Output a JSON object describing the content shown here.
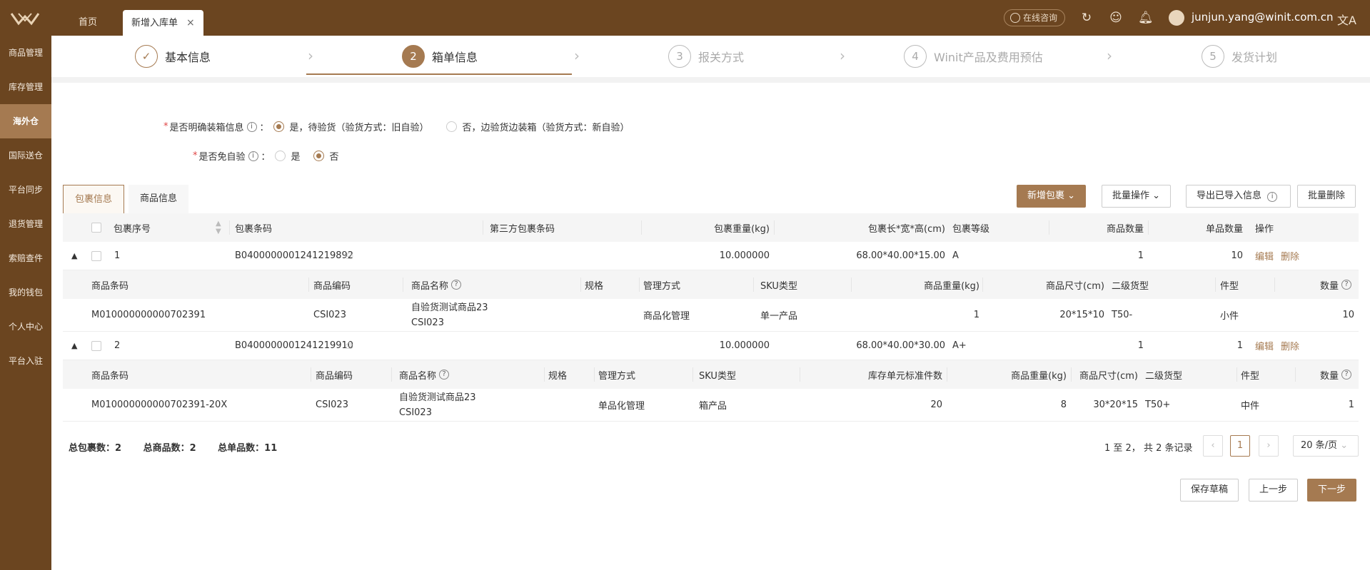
{
  "header": {
    "tabs": [
      {
        "label": "首页"
      },
      {
        "label": "新增入库单"
      }
    ],
    "consult_label": "在线咨询",
    "user": "junjun.yang@winit.com.cn",
    "lang_icon": "文A"
  },
  "sidebar": {
    "items": [
      {
        "label": "商品管理"
      },
      {
        "label": "库存管理"
      },
      {
        "label": "海外仓"
      },
      {
        "label": "国际送仓"
      },
      {
        "label": "平台同步"
      },
      {
        "label": "退货管理"
      },
      {
        "label": "索赔查件"
      },
      {
        "label": "我的钱包"
      },
      {
        "label": "个人中心"
      },
      {
        "label": "平台入驻"
      }
    ],
    "active_index": 2
  },
  "steps": [
    {
      "num": "✓",
      "label": "基本信息"
    },
    {
      "num": "2",
      "label": "箱单信息"
    },
    {
      "num": "3",
      "label": "报关方式"
    },
    {
      "num": "4",
      "label": "Winit产品及费用预估"
    },
    {
      "num": "5",
      "label": "发货计划"
    }
  ],
  "form": {
    "q1_label": "是否明确装箱信息",
    "q1_opt1": "是，待验货（验货方式：旧自验）",
    "q1_opt2": "否，边验货边装箱（验货方式：新自验）",
    "q2_label": "是否免自验",
    "q2_opt1": "是",
    "q2_opt2": "否"
  },
  "subtabs": {
    "pkg": "包裹信息",
    "goods": "商品信息"
  },
  "toolbar": {
    "add": "新增包裹",
    "batch": "批量操作",
    "export": "导出已导入信息",
    "batch_delete": "批量删除"
  },
  "table": {
    "headers": {
      "seq": "包裹序号",
      "barcode": "包裹条码",
      "third": "第三方包裹条码",
      "weight": "包裹重量(kg)",
      "dims": "包裹长*宽*高(cm)",
      "grade": "包裹等级",
      "goods_qty": "商品数量",
      "unit_qty": "单品数量",
      "ops": "操作"
    },
    "rows": [
      {
        "seq": "1",
        "barcode": "B0400000001241219892",
        "weight": "10.000000",
        "dims": "68.00*40.00*15.00",
        "grade": "A",
        "goods_qty": "1",
        "unit_qty": "10",
        "edit": "编辑",
        "del": "删除"
      },
      {
        "seq": "2",
        "barcode": "B0400000001241219910",
        "weight": "10.000000",
        "dims": "68.00*40.00*30.00",
        "grade": "A+",
        "goods_qty": "1",
        "unit_qty": "1",
        "edit": "编辑",
        "del": "删除"
      }
    ],
    "sub1": {
      "headers": {
        "barcode": "商品条码",
        "code": "商品编码",
        "name": "商品名称",
        "spec": "规格",
        "mgmt": "管理方式",
        "sku": "SKU类型",
        "weight": "商品重量(kg)",
        "size": "商品尺寸(cm)",
        "cat2": "二级货型",
        "type": "件型",
        "qty": "数量"
      },
      "row": {
        "barcode": "M010000000000702391",
        "code": "CSI023",
        "name1": "自验货测试商品23",
        "name2": "CSI023",
        "spec": "",
        "mgmt": "商品化管理",
        "sku": "单一产品",
        "weight": "1",
        "size": "20*15*10",
        "cat2": "T50-",
        "type": "小件",
        "qty": "10"
      }
    },
    "sub2": {
      "headers": {
        "barcode": "商品条码",
        "code": "商品编码",
        "name": "商品名称",
        "spec": "规格",
        "mgmt": "管理方式",
        "sku": "SKU类型",
        "std": "库存单元标准件数",
        "weight": "商品重量(kg)",
        "size": "商品尺寸(cm)",
        "cat2": "二级货型",
        "type": "件型",
        "qty": "数量"
      },
      "row": {
        "barcode": "M010000000000702391-20X",
        "code": "CSI023",
        "name1": "自验货测试商品23",
        "name2": "CSI023",
        "spec": "",
        "mgmt": "单品化管理",
        "sku": "箱产品",
        "std": "20",
        "weight": "8",
        "size": "30*20*15",
        "cat2": "T50+",
        "type": "中件",
        "qty": "1"
      }
    }
  },
  "summary": {
    "pkg": "总包裹数：2",
    "goods": "总商品数：2",
    "units": "总单品数：11"
  },
  "pager": {
    "text": "1 至 2， 共 2 条记录",
    "current": "1",
    "size": "20 条/页"
  },
  "footer": {
    "save": "保存草稿",
    "prev": "上一步",
    "next": "下一步"
  },
  "colors": {
    "brand": "#6b4520",
    "accent": "#a57a51"
  }
}
